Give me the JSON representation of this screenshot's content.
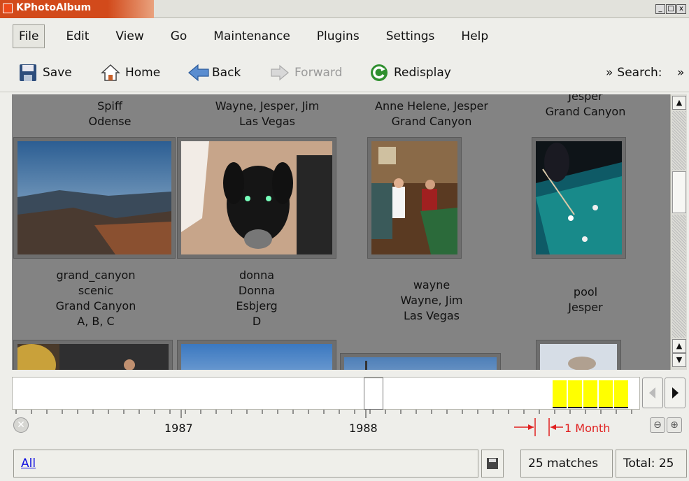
{
  "window": {
    "title": "KPhotoAlbum",
    "buttons": [
      "_",
      "□",
      "x"
    ]
  },
  "menu": {
    "items": [
      {
        "label": "File",
        "active": true
      },
      {
        "label": "Edit"
      },
      {
        "label": "View"
      },
      {
        "label": "Go"
      },
      {
        "label": "Maintenance"
      },
      {
        "label": "Plugins"
      },
      {
        "label": "Settings"
      },
      {
        "label": "Help"
      }
    ]
  },
  "toolbar": {
    "save": "Save",
    "home": "Home",
    "back": "Back",
    "forward": "Forward",
    "redisplay": "Redisplay",
    "search": "Search:",
    "overflow": "»"
  },
  "thumbnails": [
    {
      "caption": [
        "Spiff",
        "Odense"
      ],
      "icon": "grand-canyon-photo"
    },
    {
      "caption": [
        "Wayne, Jesper, Jim",
        "Las Vegas"
      ],
      "icon": "dog-photo"
    },
    {
      "caption": [
        "Anne Helene, Jesper",
        "Grand Canyon"
      ],
      "icon": "pool-players-photo"
    },
    {
      "caption": [
        "Jesper",
        "Grand Canyon"
      ],
      "icon": "pool-table-photo"
    },
    {
      "caption": [
        "grand_canyon",
        "scenic",
        "Grand Canyon",
        "A, B, C"
      ],
      "icon": "photo"
    },
    {
      "caption": [
        "donna",
        "Donna",
        "Esbjerg",
        "D"
      ],
      "icon": "sky-photo"
    },
    {
      "caption": [
        "wayne",
        "Wayne, Jim",
        "Las Vegas"
      ],
      "icon": "sky-photo"
    },
    {
      "caption": [
        "pool",
        "Jesper"
      ],
      "icon": "photo"
    }
  ],
  "timeline": {
    "years": [
      "1987",
      "1988"
    ],
    "resolution": "1 Month",
    "bar_color": "#ffff00"
  },
  "status": {
    "filter": "All",
    "matches": "25 matches",
    "total": "Total: 25"
  }
}
